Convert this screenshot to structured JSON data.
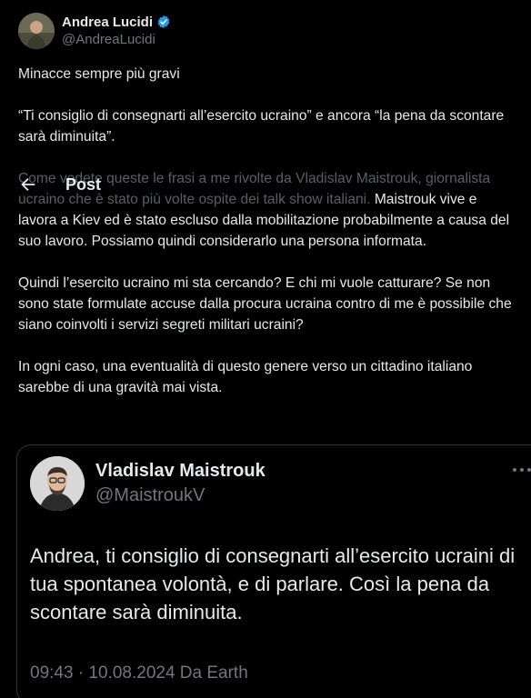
{
  "author": {
    "display_name": "Andrea Lucidi",
    "handle": "@AndreaLucidi",
    "verified": true,
    "verified_icon": "verified-badge-icon",
    "verified_color": "#1d9bf0"
  },
  "header": {
    "back_icon": "back-arrow-icon",
    "title": "Post"
  },
  "tweet": {
    "p1": "Minacce sempre più gravi",
    "p2": "“Ti consiglio di consegnarti all’esercito ucraino” e ancora “la pena da scontare sarà diminuita”.",
    "p3_dim": "Come vedete queste le frasi a me rivolte da Vladislav Maistrouk, giornalista ucraino che è stato più volte ospite dei talk show italiani.",
    "p3_rest": "Maistrouk vive e lavora a Kiev ed è stato escluso dalla mobilitazione probabilmente a causa del suo lavoro. Possiamo quindi considerarlo una persona informata.",
    "p4": "Quindi l’esercito ucraino mi sta cercando? E chi mi vuole catturare? Se non sono state formulate accuse dalla procura ucraina contro di me è possibile che siano coinvolti i servizi segreti militari ucraini?",
    "p5": "In ogni caso, una eventualità di questo genere verso un cittadino italiano sarebbe di una gravità mai vista."
  },
  "quote": {
    "display_name": "Vladislav Maistrouk",
    "handle": "@MaistroukV",
    "more_icon": "more-options-icon",
    "text": "Andrea, ti consiglio di consegnarti all’esercito ucraini di tua spontanea volontà, e di parlare. Così la pena da scontare sarà diminuita.",
    "meta": "09:43 · 10.08.2024 Da Earth"
  },
  "colors": {
    "background": "#000000",
    "text": "#e7e9ea",
    "secondary": "#71767b",
    "border": "#2f3336",
    "accent": "#1d9bf0"
  }
}
